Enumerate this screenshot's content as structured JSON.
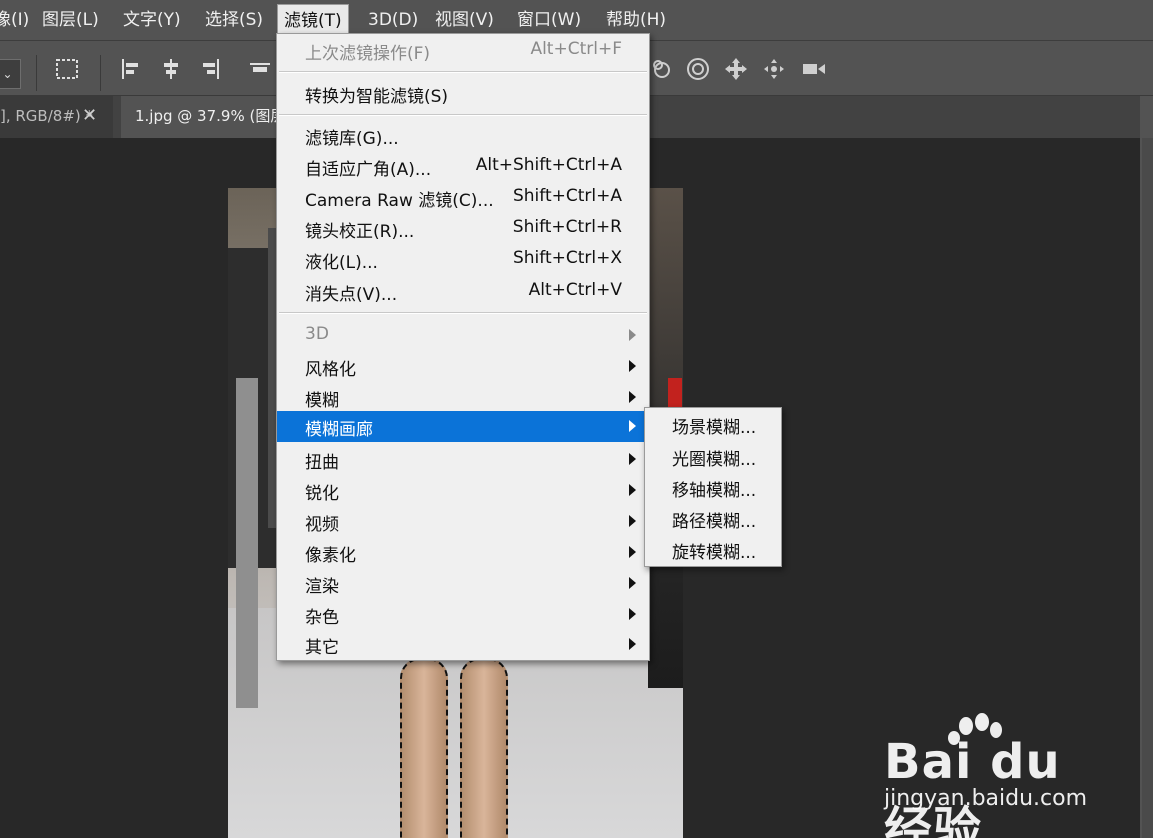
{
  "menubar": {
    "items": [
      {
        "label": "像(I)"
      },
      {
        "label": "图层(L)"
      },
      {
        "label": "文字(Y)"
      },
      {
        "label": "选择(S)"
      },
      {
        "label": "滤镜(T)",
        "active": true
      },
      {
        "label": "3D(D)"
      },
      {
        "label": "视图(V)"
      },
      {
        "label": "窗口(W)"
      },
      {
        "label": "帮助(H)"
      }
    ]
  },
  "options": {
    "dropdown_glyph": "⌄",
    "icons": [
      "marquee-transform-icon",
      "align-left-icon",
      "align-center-icon",
      "align-right-icon",
      "distribute-icon",
      "3d-orbit-icon",
      "3d-roll-icon",
      "3d-pan-icon",
      "3d-slide-icon",
      "3d-camera-icon"
    ]
  },
  "tabs": [
    {
      "label": "], RGB/8#) *",
      "close": "✕"
    },
    {
      "label": "1.jpg @ 37.9% (图层"
    }
  ],
  "filter_menu": {
    "items": [
      {
        "label": "上次滤镜操作(F)",
        "shortcut": "Alt+Ctrl+F",
        "disabled": true
      },
      {
        "label": "转换为智能滤镜(S)"
      },
      {
        "label": "滤镜库(G)..."
      },
      {
        "label": "自适应广角(A)...",
        "shortcut": "Alt+Shift+Ctrl+A"
      },
      {
        "label": "Camera Raw 滤镜(C)...",
        "shortcut": "Shift+Ctrl+A"
      },
      {
        "label": "镜头校正(R)...",
        "shortcut": "Shift+Ctrl+R"
      },
      {
        "label": "液化(L)...",
        "shortcut": "Shift+Ctrl+X"
      },
      {
        "label": "消失点(V)...",
        "shortcut": "Alt+Ctrl+V"
      },
      {
        "label": "3D",
        "disabled": true,
        "submenu": true
      },
      {
        "label": "风格化",
        "submenu": true
      },
      {
        "label": "模糊",
        "submenu": true
      },
      {
        "label": "模糊画廊",
        "submenu": true,
        "highlighted": true
      },
      {
        "label": "扭曲",
        "submenu": true
      },
      {
        "label": "锐化",
        "submenu": true
      },
      {
        "label": "视频",
        "submenu": true
      },
      {
        "label": "像素化",
        "submenu": true
      },
      {
        "label": "渲染",
        "submenu": true
      },
      {
        "label": "杂色",
        "submenu": true
      },
      {
        "label": "其它",
        "submenu": true
      }
    ]
  },
  "blur_gallery_submenu": {
    "items": [
      {
        "label": "场景模糊..."
      },
      {
        "label": "光圈模糊..."
      },
      {
        "label": "移轴模糊..."
      },
      {
        "label": "路径模糊..."
      },
      {
        "label": "旋转模糊..."
      }
    ]
  },
  "watermark": {
    "logo": "Bai du 经验",
    "url": "jingyan.baidu.com"
  },
  "colors": {
    "menubar_bg": "#535353",
    "menu_bg": "#f0f0f0",
    "highlight": "#0b73d8",
    "workspace": "#282828"
  }
}
